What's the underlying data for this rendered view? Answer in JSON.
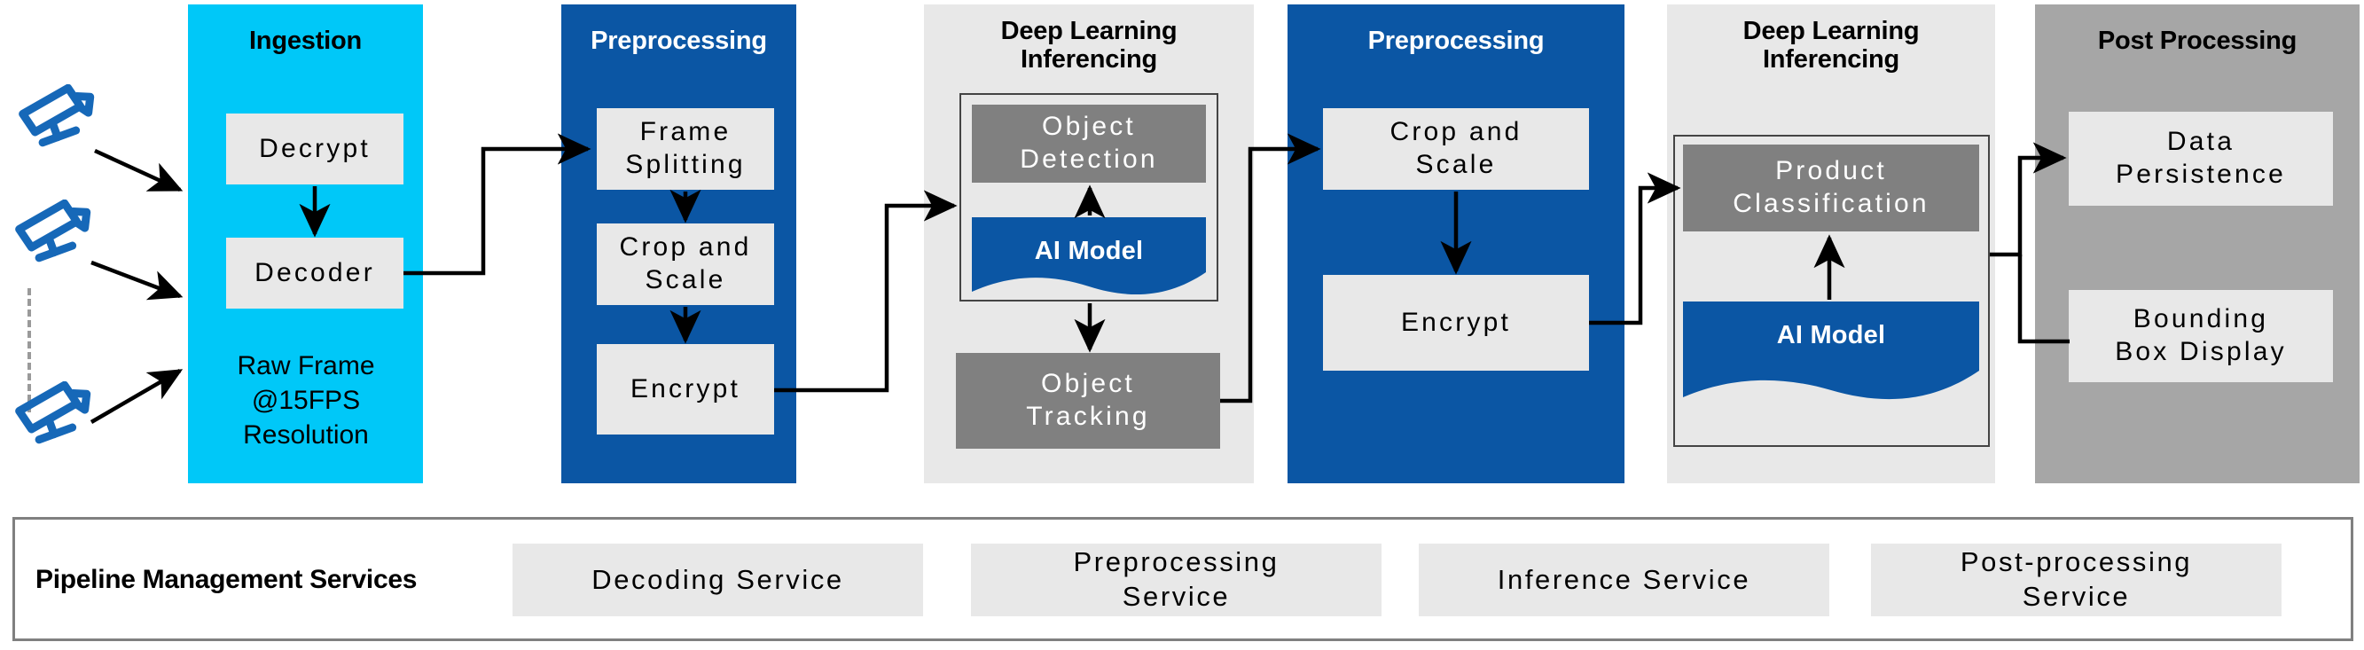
{
  "diagram": {
    "title": "Video analytics pipeline",
    "colors": {
      "ingestion_bg": "#00c8f8",
      "preprocessing_bg": "#0b56a4",
      "inferencing_bg": "#e8e8e8",
      "postprocessing_bg": "#a6a6a6",
      "proc_box_bg": "#e8e8e8",
      "dark_box_bg": "#808080",
      "ai_model_bg": "#0b56a4",
      "camera_icon": "#1668b8",
      "connector": "#000000"
    }
  },
  "sources": {
    "icon": "cctv-camera-icon",
    "count_shown": 3,
    "continuation": "dashed-vertical-line"
  },
  "stages": [
    {
      "id": "ingestion",
      "title": "Ingestion",
      "title_color": "#000000",
      "bg": "#00c8f8",
      "boxes": [
        {
          "id": "decrypt",
          "label": "Decrypt",
          "style": "light"
        },
        {
          "id": "decoder",
          "label": "Decoder",
          "style": "light"
        }
      ],
      "note_lines": [
        "Raw Frame",
        "@15FPS",
        "Resolution"
      ]
    },
    {
      "id": "preprocessing-1",
      "title": "Preprocessing",
      "title_color": "#ffffff",
      "bg": "#0b56a4",
      "boxes": [
        {
          "id": "frame-splitting",
          "label": "Frame\nSplitting",
          "style": "light"
        },
        {
          "id": "crop-and-scale-1",
          "label": "Crop and\nScale",
          "style": "light"
        },
        {
          "id": "encrypt-1",
          "label": "Encrypt",
          "style": "light"
        }
      ]
    },
    {
      "id": "deep-learning-inferencing-1",
      "title": "Deep Learning\nInferencing",
      "title_color": "#000000",
      "bg": "#e8e8e8",
      "boxes": [
        {
          "id": "object-detection",
          "label": "Object\nDetection",
          "style": "dark"
        },
        {
          "id": "ai-model-1",
          "label": "AI Model",
          "style": "ai"
        },
        {
          "id": "object-tracking",
          "label": "Object\nTracking",
          "style": "dark"
        }
      ]
    },
    {
      "id": "preprocessing-2",
      "title": "Preprocessing",
      "title_color": "#ffffff",
      "bg": "#0b56a4",
      "boxes": [
        {
          "id": "crop-and-scale-2",
          "label": "Crop and\nScale",
          "style": "light"
        },
        {
          "id": "encrypt-2",
          "label": "Encrypt",
          "style": "light"
        }
      ]
    },
    {
      "id": "deep-learning-inferencing-2",
      "title": "Deep Learning\nInferencing",
      "title_color": "#000000",
      "bg": "#e8e8e8",
      "boxes": [
        {
          "id": "product-classification",
          "label": "Product\nClassification",
          "style": "dark"
        },
        {
          "id": "ai-model-2",
          "label": "AI Model",
          "style": "ai"
        }
      ]
    },
    {
      "id": "post-processing",
      "title": "Post Processing",
      "title_color": "#000000",
      "bg": "#a6a6a6",
      "boxes": [
        {
          "id": "data-persistence",
          "label": "Data\nPersistence",
          "style": "light"
        },
        {
          "id": "bounding-box-display",
          "label": "Bounding\nBox Display",
          "style": "light"
        }
      ]
    }
  ],
  "labels": {
    "ingestion_title": "Ingestion",
    "preprocessing_title_1": "Preprocessing",
    "dl_title_1_line1": "Deep Learning",
    "dl_title_1_line2": "Inferencing",
    "preprocessing_title_2": "Preprocessing",
    "dl_title_2_line1": "Deep Learning",
    "dl_title_2_line2": "Inferencing",
    "postprocessing_title": "Post Processing",
    "decrypt": "Decrypt",
    "decoder": "Decoder",
    "raw_frame_l1": "Raw Frame",
    "raw_frame_l2": "@15FPS",
    "raw_frame_l3": "Resolution",
    "frame_splitting_l1": "Frame",
    "frame_splitting_l2": "Splitting",
    "crop_scale_1_l1": "Crop and",
    "crop_scale_1_l2": "Scale",
    "encrypt_1": "Encrypt",
    "object_detection_l1": "Object",
    "object_detection_l2": "Detection",
    "ai_model_1": "AI Model",
    "object_tracking_l1": "Object",
    "object_tracking_l2": "Tracking",
    "crop_scale_2_l1": "Crop and",
    "crop_scale_2_l2": "Scale",
    "encrypt_2": "Encrypt",
    "product_classification_l1": "Product",
    "product_classification_l2": "Classification",
    "ai_model_2": "AI Model",
    "data_persistence_l1": "Data",
    "data_persistence_l2": "Persistence",
    "bounding_box_l1": "Bounding",
    "bounding_box_l2": "Box Display"
  },
  "services_bar": {
    "title": "Pipeline Management Services",
    "items": [
      {
        "id": "decoding-service",
        "label": "Decoding Service",
        "line1": "Decoding Service",
        "line2": ""
      },
      {
        "id": "preprocessing-service",
        "label": "Preprocessing Service",
        "line1": "Preprocessing",
        "line2": "Service"
      },
      {
        "id": "inference-service",
        "label": "Inference Service",
        "line1": "Inference Service",
        "line2": ""
      },
      {
        "id": "post-processing-service",
        "label": "Post-processing Service",
        "line1": "Post-processing",
        "line2": "Service"
      }
    ]
  }
}
